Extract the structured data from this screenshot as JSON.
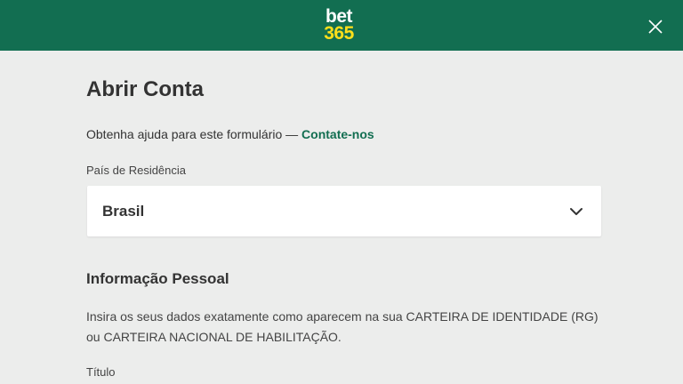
{
  "header": {
    "logo_top": "bet",
    "logo_bottom": "365",
    "close_icon": "close-icon"
  },
  "form": {
    "title": "Abrir Conta",
    "help_text": "Obtenha ajuda para este formulário — ",
    "help_link": "Contate-nos",
    "country_label": "País de Residência",
    "country_value": "Brasil",
    "country_icon": "chevron-down-icon",
    "section_title": "Informação Pessoal",
    "instructions": "Insira os seus dados exatamente como aparecem na sua CARTEIRA DE IDENTIDADE (RG) ou CARTEIRA NACIONAL DE HABILITAÇÃO.",
    "title_label": "Título"
  },
  "colors": {
    "brand_green": "#126e51",
    "brand_yellow": "#ffdf1b",
    "background": "#ecedec"
  }
}
